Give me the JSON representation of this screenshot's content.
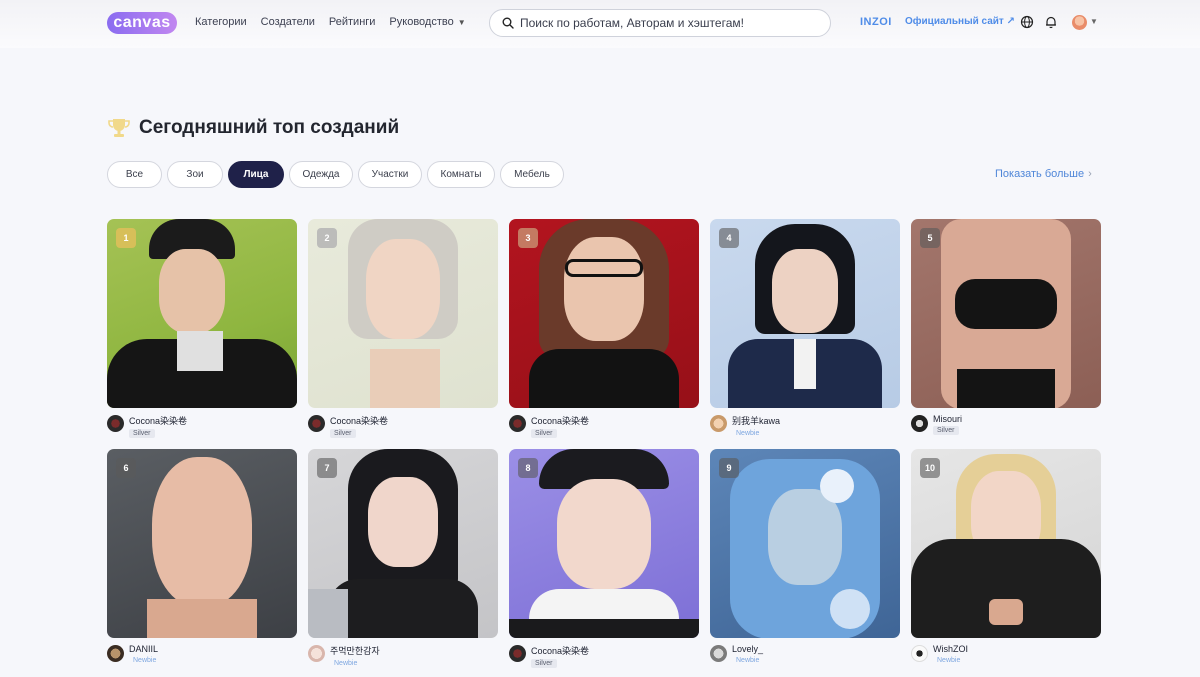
{
  "header": {
    "logo": "canvas",
    "nav": [
      {
        "label": "Категории"
      },
      {
        "label": "Создатели"
      },
      {
        "label": "Рейтинги"
      },
      {
        "label": "Руководство"
      }
    ],
    "search_placeholder": "Поиск по работам, Авторам и хэштегам!",
    "brand": "INZOI",
    "official_site": "Официальный сайт ↗"
  },
  "section": {
    "title": "Сегодняшний топ созданий",
    "show_more": "Показать больше"
  },
  "chips": [
    {
      "label": "Все",
      "active": false
    },
    {
      "label": "Зои",
      "active": false
    },
    {
      "label": "Лица",
      "active": true
    },
    {
      "label": "Одежда",
      "active": false
    },
    {
      "label": "Участки",
      "active": false
    },
    {
      "label": "Комнаты",
      "active": false
    },
    {
      "label": "Мебель",
      "active": false
    }
  ],
  "cards": [
    {
      "rank": "1",
      "author": "Cocona染染卷",
      "tier": "Silver"
    },
    {
      "rank": "2",
      "author": "Cocona染染卷",
      "tier": "Silver"
    },
    {
      "rank": "3",
      "author": "Cocona染染卷",
      "tier": "Silver"
    },
    {
      "rank": "4",
      "author": "别我羊kawa",
      "tier": "Newbie"
    },
    {
      "rank": "5",
      "author": "Misouri",
      "tier": "Silver"
    },
    {
      "rank": "6",
      "author": "DANIIL",
      "tier": "Newbie"
    },
    {
      "rank": "7",
      "author": "주먹만한감자",
      "tier": "Newbie"
    },
    {
      "rank": "8",
      "author": "Cocona染染卷",
      "tier": "Silver"
    },
    {
      "rank": "9",
      "author": "Lovely_",
      "tier": "Newbie"
    },
    {
      "rank": "10",
      "author": "WishZOI",
      "tier": "Newbie"
    }
  ],
  "colors": {
    "accent": "#1f2149",
    "link": "#4f86d8",
    "logo_gradient": [
      "#8a6cf0",
      "#c187f0"
    ]
  },
  "icons": [
    "search-icon",
    "globe-icon",
    "bell-icon",
    "trophy-icon",
    "external-link-icon",
    "chevron-down-icon",
    "chevron-right-icon"
  ]
}
